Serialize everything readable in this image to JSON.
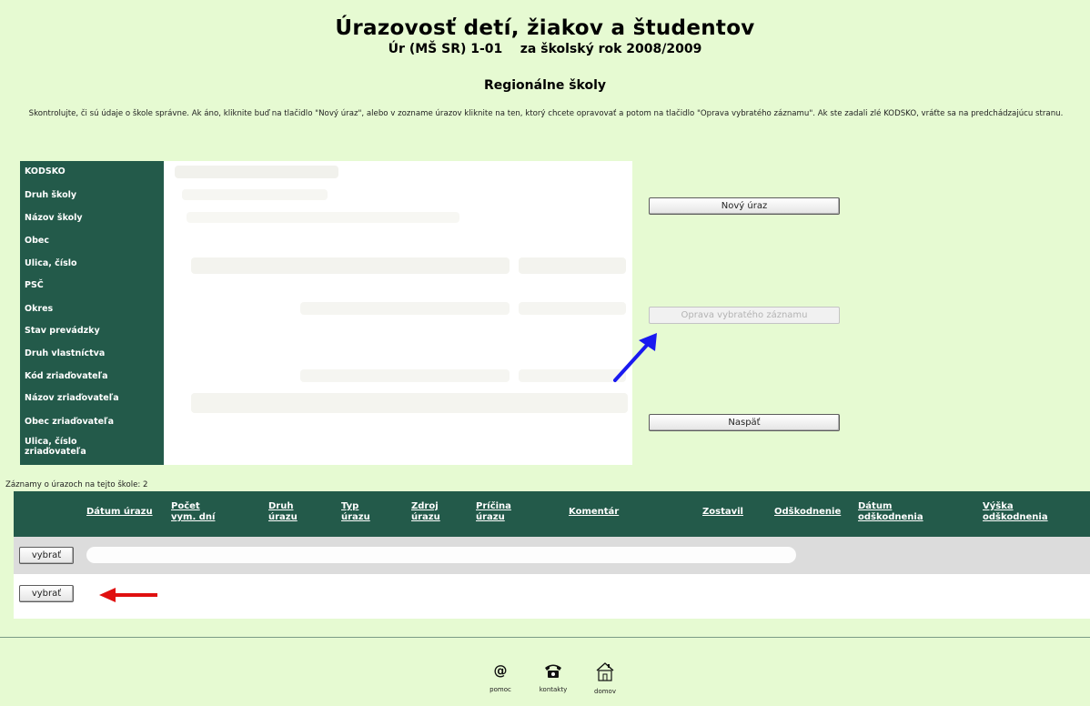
{
  "header": {
    "title": "Úrazovosť detí, žiakov a študentov",
    "subtitle": "Úr (MŠ SR) 1-01    za školský rok 2008/2009",
    "section": "Regionálne školy",
    "instructions": "Skontrolujte, či sú údaje o škole správne. Ak áno, kliknite buď na tlačidlo \"Nový úraz\", alebo v zozname úrazov kliknite na ten, ktorý chcete opravovať a potom na tlačidlo \"Oprava vybratého záznamu\". Ak ste zadali zlé KODSKO, vráťte sa na predchádzajúcu stranu."
  },
  "form": {
    "labels": [
      "KODSKO",
      "Druh školy",
      "Názov školy",
      "Obec",
      "Ulica, číslo",
      "PSČ",
      "Okres",
      "Stav prevádzky",
      "Druh vlastníctva",
      "Kód zriaďovateľa",
      "Názov zriaďovateľa",
      "Obec zriaďovateľa",
      "Ulica, číslo zriaďovateľa"
    ]
  },
  "buttons": {
    "new_injury": "Nový úraz",
    "edit_selected": "Oprava vybratého záznamu",
    "back": "Naspäť"
  },
  "records": {
    "count_label": "Záznamy o úrazoch na tejto škole: 2",
    "columns": [
      "Dátum úrazu",
      "Počet vym. dní",
      "Druh úrazu",
      "Typ úrazu",
      "Zdroj úrazu",
      "Príčina úrazu",
      "Komentár",
      "Zostavil",
      "Odškodnenie",
      "Dátum odškodnenia",
      "Výška odškodnenia"
    ],
    "rows": [
      {
        "select_label": "vybrať"
      },
      {
        "select_label": "vybrať"
      }
    ]
  },
  "footer": {
    "items": [
      {
        "label": "pomoc",
        "icon": "at-icon"
      },
      {
        "label": "kontakty",
        "icon": "phone-icon"
      },
      {
        "label": "domov",
        "icon": "home-icon"
      }
    ]
  },
  "colors": {
    "background": "#e6fad2",
    "header_bg": "#235a4a",
    "annotation_blue": "#1a1af0",
    "annotation_red": "#e01010"
  }
}
